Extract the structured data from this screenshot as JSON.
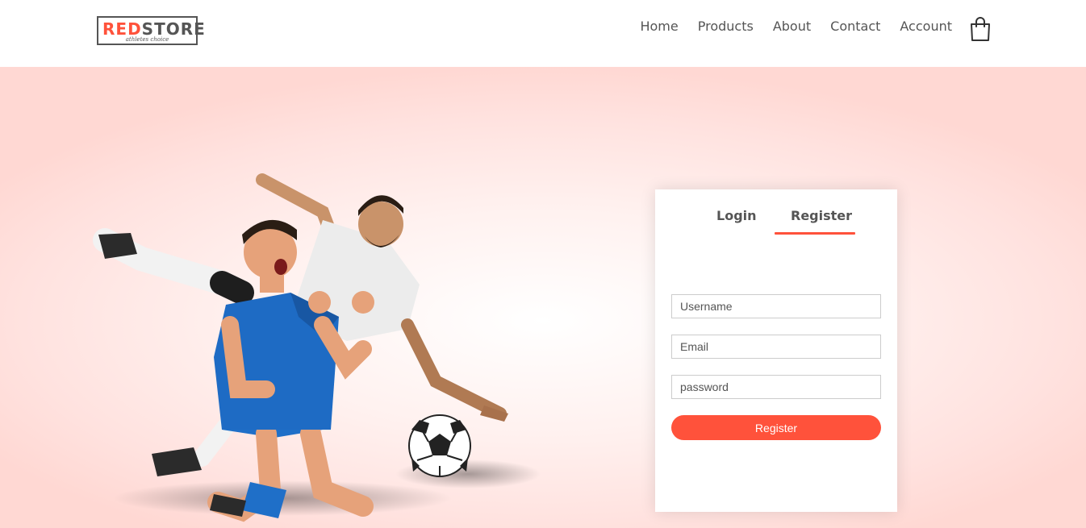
{
  "brand": {
    "name_red": "RED",
    "name_dark": "STORE",
    "tagline": "athletes choice",
    "accent_color": "#ff523b"
  },
  "nav": {
    "items": [
      {
        "label": "Home"
      },
      {
        "label": "Products"
      },
      {
        "label": "About"
      },
      {
        "label": "Contact"
      },
      {
        "label": "Account"
      }
    ],
    "cart_icon": "shopping-bag-icon"
  },
  "hero": {
    "image": "football-players-photo"
  },
  "form": {
    "tabs": {
      "login": "Login",
      "register": "Register",
      "active": "register"
    },
    "username_placeholder": "Username",
    "email_placeholder": "Email",
    "password_placeholder": "password",
    "submit_label": "Register"
  }
}
